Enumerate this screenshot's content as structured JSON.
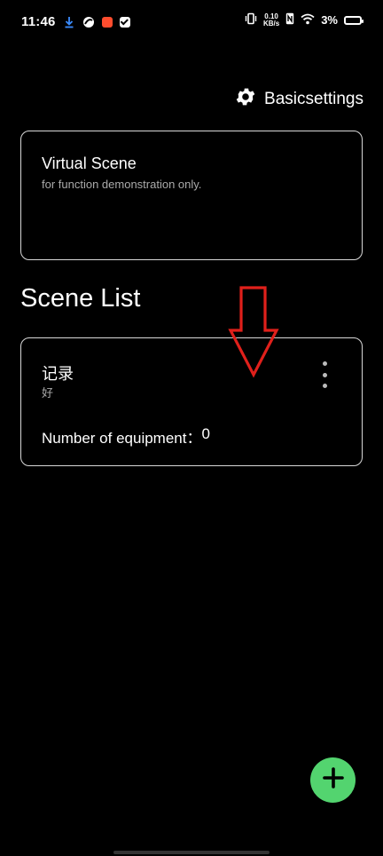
{
  "status_bar": {
    "time": "11:46",
    "net_speed_value": "0.10",
    "net_speed_unit": "KB/s",
    "battery_percent": "3%"
  },
  "header": {
    "settings_label": "Basicsettings",
    "settings_icon": "gear-icon"
  },
  "virtual_scene": {
    "title": "Virtual Scene",
    "subtitle": "for function demonstration only."
  },
  "scene_list": {
    "title": "Scene List",
    "items": [
      {
        "name": "记录",
        "description": "好",
        "equipment_label": "Number of equipment：",
        "equipment_count": "0"
      }
    ]
  },
  "fab": {
    "icon": "plus-icon",
    "color": "#53d46f"
  },
  "annotation": {
    "icon": "down-arrow-icon",
    "color": "#e0201b"
  }
}
